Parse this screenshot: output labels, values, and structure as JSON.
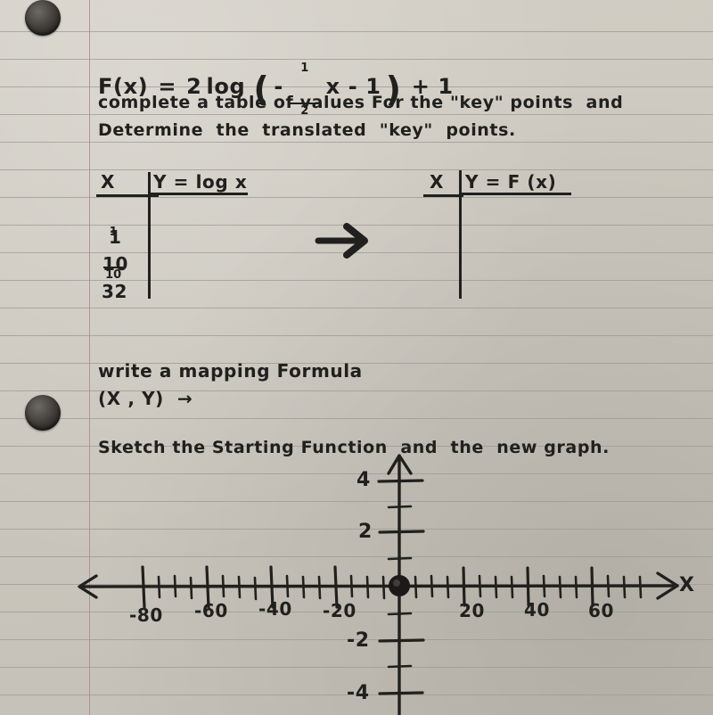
{
  "page": {
    "type": "handwritten-math-worksheet",
    "paper": "lined loose-leaf notebook paper",
    "paper_color": "#cdc8bf",
    "rule_color": "#9d9a93",
    "margin_line_color": "#b08a92",
    "ink_color": "#20201e"
  },
  "equation": {
    "full": "F(x) = 2log(-1/2 x - 1) + 1",
    "lhs": "F(x)",
    "equals": "=",
    "coefficient": "2",
    "log": "log",
    "open_paren": "(",
    "minus": "-",
    "fraction_num": "1",
    "fraction_den": "2",
    "variable": "x",
    "inner_minus": "- 1",
    "close_paren": ")",
    "outer_add": "+ 1"
  },
  "instructions": {
    "line1": "complete a table of values For the \"key\" points  and",
    "line2": "Determine  the  translated  \"key\"  points."
  },
  "table_left": {
    "header_x": "X",
    "header_y": "Y = log x",
    "rows": [
      {
        "x_num": "1",
        "x_den": "10",
        "is_fraction": true,
        "y": ""
      },
      {
        "x": "1",
        "is_fraction": false,
        "y": ""
      },
      {
        "x": "10",
        "is_fraction": false,
        "y": ""
      },
      {
        "x": "32",
        "is_fraction": false,
        "y": ""
      }
    ]
  },
  "arrow_between_tables": "→",
  "table_right": {
    "header_x": "X",
    "header_y": "Y = F (x)",
    "rows": [
      {
        "x": "",
        "y": ""
      },
      {
        "x": "",
        "y": ""
      },
      {
        "x": "",
        "y": ""
      },
      {
        "x": "",
        "y": ""
      }
    ]
  },
  "mapping": {
    "line1": "write a mapping Formula",
    "line2": "(X , Y)  →"
  },
  "sketch": {
    "line1": "Sketch the Starting Function  and  the  new graph."
  },
  "chart_data": {
    "type": "line",
    "title": "",
    "xlabel": "X",
    "ylabel": "",
    "xlim": [
      -95,
      80
    ],
    "ylim": [
      -5.6,
      5.4
    ],
    "x_major_ticks": [
      -80,
      -60,
      -40,
      -20,
      20,
      40,
      60
    ],
    "x_major_tick_labels": [
      "-80",
      "-60",
      "-40",
      "-20",
      "20",
      "40",
      "60"
    ],
    "x_minor_tick_step": 5,
    "y_major_ticks": [
      4,
      2,
      -2,
      -4
    ],
    "y_major_tick_labels": [
      "4",
      "2",
      "-2",
      "-4"
    ],
    "y_minor_tick_step": 1,
    "grid": false,
    "legend": "none",
    "axis_arrows": [
      "left",
      "right",
      "up"
    ],
    "origin_marker": {
      "label": "origin-dot",
      "x": 0,
      "y": 0,
      "style": "filled-dot"
    },
    "series": [],
    "note": "empty coordinate grid drawn by hand; no curve plotted yet"
  }
}
